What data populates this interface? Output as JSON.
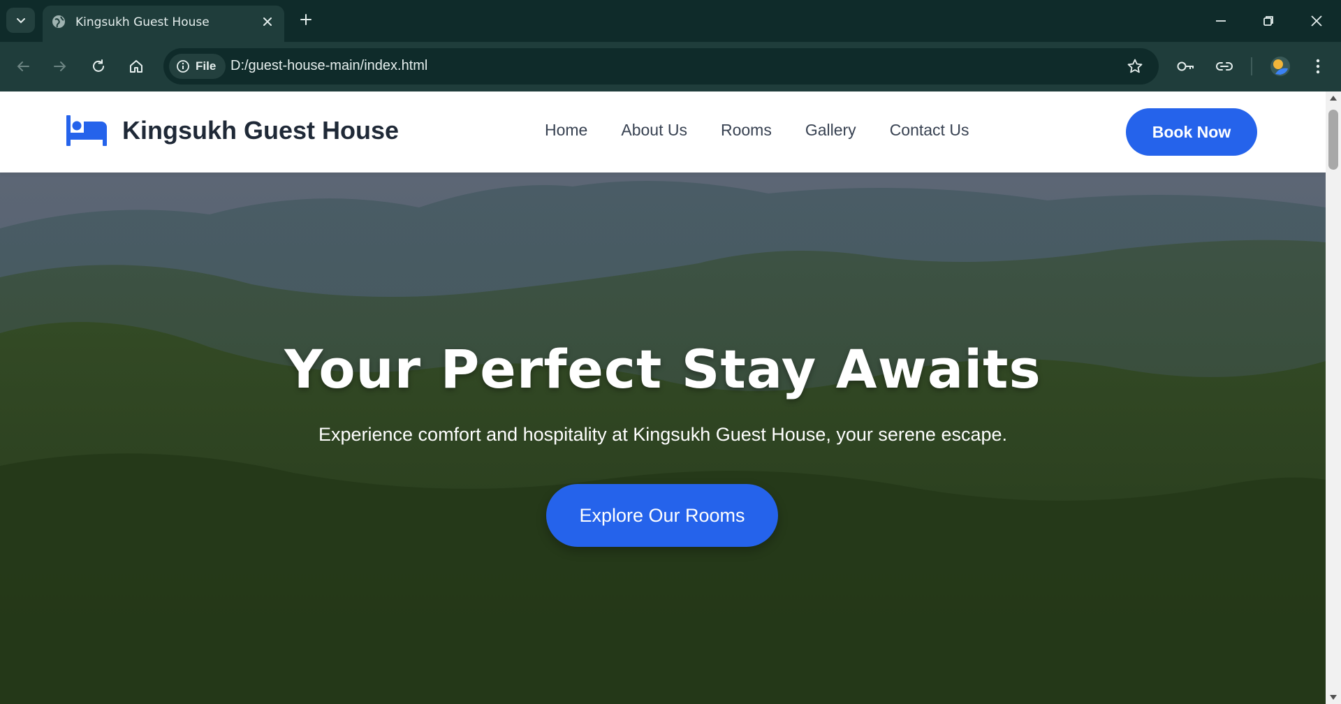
{
  "browser": {
    "tab_title": "Kingsukh Guest House",
    "site_chip_label": "File",
    "url": "D:/guest-house-main/index.html"
  },
  "site": {
    "brand_name": "Kingsukh Guest House",
    "nav": [
      "Home",
      "About Us",
      "Rooms",
      "Gallery",
      "Contact Us"
    ],
    "cta_label": "Book Now",
    "accent_color": "#2563eb"
  },
  "hero": {
    "title": "Your Perfect Stay Awaits",
    "subtitle": "Experience comfort and hospitality at Kingsukh Guest House, your serene escape.",
    "button_label": "Explore Our Rooms"
  }
}
